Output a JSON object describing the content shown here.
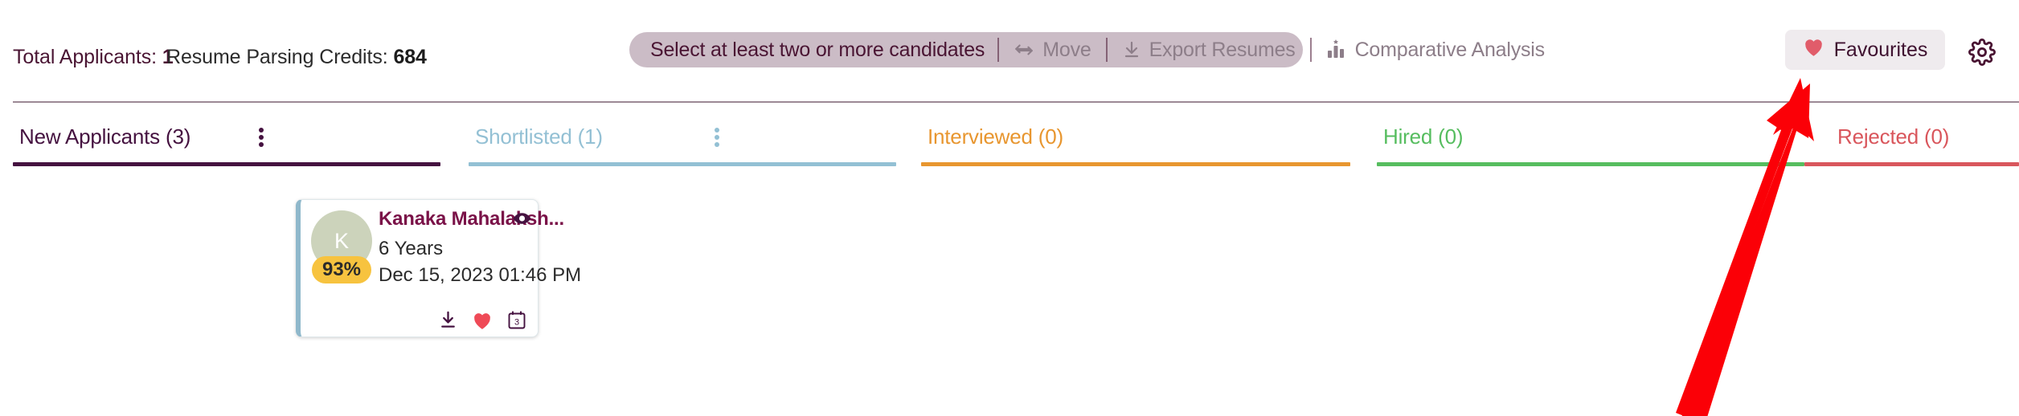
{
  "stats": {
    "total_applicants_label": "Total Applicants:",
    "total_applicants_value": "1",
    "credits_label": "Resume Parsing Credits:",
    "credits_value": "684"
  },
  "action_bar": {
    "hint": "Select at least two or more candidates",
    "buttons": [
      {
        "label": "Move",
        "icon": "move-arrows-icon",
        "disabled": true
      },
      {
        "label": "Export Resumes",
        "icon": "download-icon",
        "disabled": true
      },
      {
        "label": "Comparative Analysis",
        "icon": "bar-chart-star-icon",
        "disabled": true
      }
    ],
    "background_color": "#cbbcc6",
    "disabled_text_color": "#8d7e89"
  },
  "favourites": {
    "label": "Favourites",
    "icon": "heart-icon",
    "icon_color": "#e15c6a",
    "background_color": "#efebee"
  },
  "settings": {
    "icon": "gear-icon",
    "color": "#4a1533"
  },
  "tabs": [
    {
      "label": "New Applicants (3)",
      "color": "#451240",
      "underline_color": "#451240",
      "has_menu": true,
      "menu_icon": "vertical-dots-icon",
      "menu_color": "#451240"
    },
    {
      "label": "Shortlisted (1)",
      "color": "#93c0d4",
      "underline_color": "#93c0d4",
      "has_menu": true,
      "menu_icon": "vertical-dots-icon",
      "menu_color": "#93c0d4"
    },
    {
      "label": "Interviewed (0)",
      "color": "#e8962f",
      "underline_color": "#e8962f",
      "has_menu": false,
      "menu_icon": "",
      "menu_color": ""
    },
    {
      "label": "Hired (0)",
      "color": "#56bd5f",
      "underline_color": "#56bd5f",
      "has_menu": false,
      "menu_icon": "",
      "menu_color": ""
    },
    {
      "label": "Rejected (0)",
      "color": "#d9565c",
      "underline_color": "#d9565c",
      "has_menu": false,
      "menu_icon": "",
      "menu_color": ""
    }
  ],
  "candidate_card": {
    "avatar_initial": "K",
    "avatar_color": "#ccd3bb",
    "match_score": "93%",
    "score_color": "#f7c33f",
    "name": "Kanaka Mahalaksh...",
    "name_color": "#7a1248",
    "preview_icon": "eye-icon",
    "experience": "6 Years",
    "applied_at": "Dec 15, 2023 01:46 PM",
    "accent_color": "#8fb8cb",
    "actions": [
      {
        "icon": "download-icon",
        "color": "#451240"
      },
      {
        "icon": "heart-icon",
        "color": "#ef4a57"
      },
      {
        "icon": "calendar-icon",
        "color": "#451240",
        "day": "3"
      }
    ]
  },
  "annotation": {
    "type": "arrow",
    "color": "#fb0007",
    "points_to": "favourites-button"
  }
}
